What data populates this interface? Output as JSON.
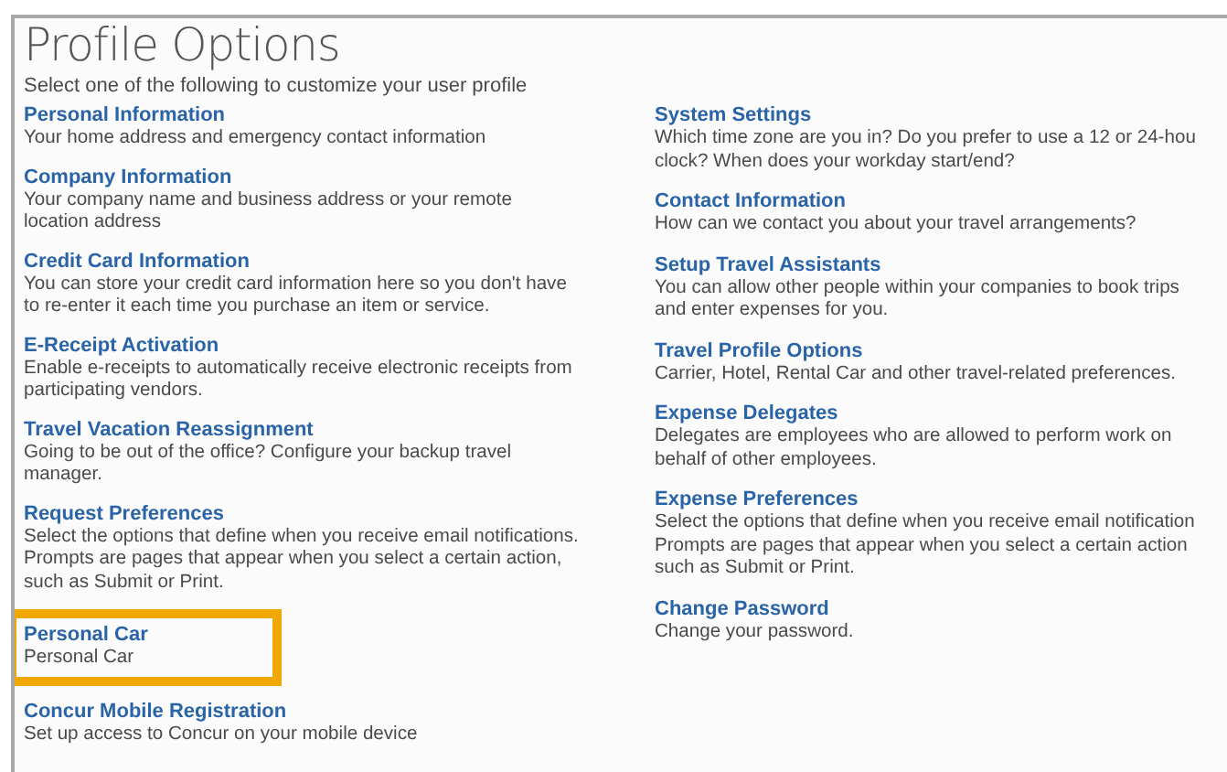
{
  "title": "Profile Options",
  "subtitle": "Select one of the following to customize your user profile",
  "left": [
    {
      "title": "Personal Information",
      "lines": [
        "Your home address and emergency contact information"
      ],
      "highlighted": false
    },
    {
      "title": "Company Information",
      "lines": [
        "Your company name and business address or your remote",
        "location address"
      ],
      "highlighted": false
    },
    {
      "title": "Credit Card Information",
      "lines": [
        "You can store your credit card information here so you don't have",
        "to re-enter it each time you purchase an item or service."
      ],
      "highlighted": false
    },
    {
      "title": "E-Receipt Activation",
      "lines": [
        "Enable e-receipts to automatically receive electronic receipts from",
        "participating vendors."
      ],
      "highlighted": false
    },
    {
      "title": "Travel Vacation Reassignment",
      "lines": [
        "Going to be out of the office? Configure your backup travel",
        "manager."
      ],
      "highlighted": false
    },
    {
      "title": "Request Preferences",
      "lines": [
        "Select the options that define when you receive email notifications.",
        "Prompts are pages that appear when you select a certain action,",
        "such as Submit or Print."
      ],
      "highlighted": false
    },
    {
      "title": "Personal Car",
      "lines": [
        "Personal Car"
      ],
      "highlighted": true
    },
    {
      "title": "Concur Mobile Registration",
      "lines": [
        "Set up access to Concur on your mobile device"
      ],
      "highlighted": false
    }
  ],
  "right": [
    {
      "title": "System Settings",
      "lines": [
        "Which time zone are you in? Do you prefer to use a 12 or 24-hou",
        "clock? When does your workday start/end?"
      ],
      "highlighted": false
    },
    {
      "title": "Contact Information",
      "lines": [
        "How can we contact you about your travel arrangements?"
      ],
      "highlighted": false
    },
    {
      "title": "Setup Travel Assistants",
      "lines": [
        "You can allow other people within your companies to book trips",
        "and enter expenses for you."
      ],
      "highlighted": false
    },
    {
      "title": "Travel Profile Options",
      "lines": [
        "Carrier, Hotel, Rental Car and other travel-related preferences."
      ],
      "highlighted": false
    },
    {
      "title": "Expense Delegates",
      "lines": [
        "Delegates are employees who are allowed to perform work on",
        "behalf of other employees."
      ],
      "highlighted": false
    },
    {
      "title": "Expense Preferences",
      "lines": [
        "Select the options that define when you receive email notification",
        "Prompts are pages that appear when you select a certain action",
        "such as Submit or Print."
      ],
      "highlighted": false
    },
    {
      "title": "Change Password",
      "lines": [
        "Change your password."
      ],
      "highlighted": false
    }
  ]
}
